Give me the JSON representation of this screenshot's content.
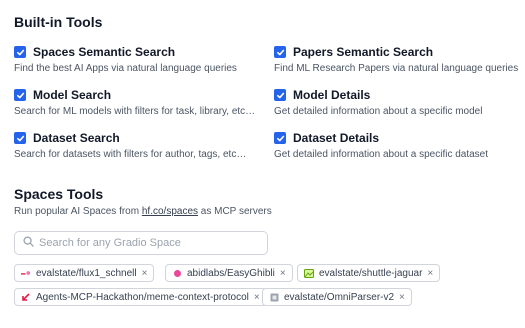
{
  "builtin": {
    "title": "Built-in Tools",
    "tools": [
      {
        "name": "Spaces Semantic Search",
        "desc": "Find the best AI Apps via natural language queries",
        "checked": true
      },
      {
        "name": "Papers Semantic Search",
        "desc": "Find ML Research Papers via natural language queries",
        "checked": true
      },
      {
        "name": "Model Search",
        "desc": "Search for ML models with filters for task, library, etc…",
        "checked": true
      },
      {
        "name": "Model Details",
        "desc": "Get detailed information about a specific model",
        "checked": true
      },
      {
        "name": "Dataset Search",
        "desc": "Search for datasets with filters for author, tags, etc…",
        "checked": true
      },
      {
        "name": "Dataset Details",
        "desc": "Get detailed information about a specific dataset",
        "checked": true
      }
    ]
  },
  "spaces": {
    "title": "Spaces Tools",
    "subtitle_prefix": "Run popular AI Spaces from ",
    "subtitle_link": "hf.co/spaces",
    "subtitle_suffix": " as MCP servers",
    "search_placeholder": "Search for any Gradio Space",
    "remove_glyph": "×",
    "chips": [
      {
        "label": "evalstate/flux1_schnell",
        "icon": "flux-icon",
        "color": "#e11d48"
      },
      {
        "label": "abidlabs/EasyGhibli",
        "icon": "ghibli-icon",
        "color": "#db2777"
      },
      {
        "label": "evalstate/shuttle-jaguar",
        "icon": "image-icon",
        "color": "#65a30d"
      },
      {
        "label": "Agents-MCP-Hackathon/meme-context-protocol",
        "icon": "arrow-icon",
        "color": "#e11d48"
      },
      {
        "label": "evalstate/OmniParser-v2",
        "icon": "parser-icon",
        "color": "#6b7280"
      }
    ]
  },
  "colors": {
    "accent": "#2563eb",
    "border": "#d1d5db"
  }
}
